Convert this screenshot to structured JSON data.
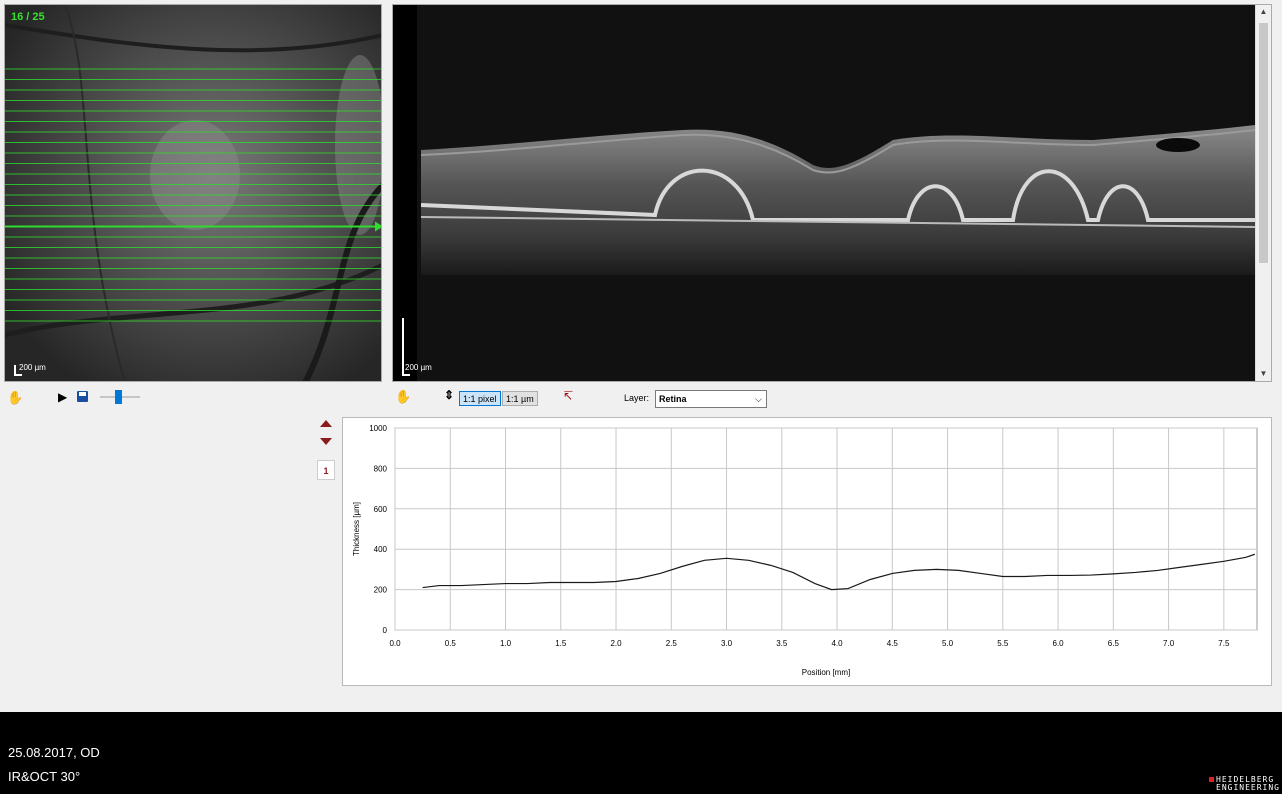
{
  "fundus": {
    "scan_counter": "16 / 25",
    "scale_label": "200 µm",
    "scan_count": 25,
    "selected_scan": 16,
    "scan_color": "#2fdb2f"
  },
  "oct": {
    "scale_label": "200 µm"
  },
  "toolbar": {
    "pan_icon": "hand-icon",
    "play_icon": "play-icon",
    "save_icon": "save-icon",
    "brightness_level": 0.45,
    "pixel_label": "1:1 pixel",
    "micron_label": "1:1 µm",
    "layer_label": "Layer:",
    "layer_value": "Retina"
  },
  "side_controls": {
    "up_icon": "arrow-up-icon",
    "down_icon": "arrow-down-icon",
    "badge": "1"
  },
  "chart_data": {
    "type": "line",
    "xlabel": "Position [mm]",
    "ylabel": "Thickness [µm]",
    "xlim": [
      0.0,
      7.8
    ],
    "ylim": [
      0,
      1000
    ],
    "xticks": [
      "0.0",
      "0.5",
      "1.0",
      "1.5",
      "2.0",
      "2.5",
      "3.0",
      "3.5",
      "4.0",
      "4.5",
      "5.0",
      "5.5",
      "6.0",
      "6.5",
      "7.0",
      "7.5"
    ],
    "yticks": [
      "0",
      "200",
      "400",
      "600",
      "800",
      "1000"
    ],
    "grid": true,
    "x": [
      0.25,
      0.4,
      0.6,
      0.8,
      1.0,
      1.2,
      1.4,
      1.6,
      1.8,
      2.0,
      2.2,
      2.4,
      2.6,
      2.8,
      3.0,
      3.2,
      3.4,
      3.6,
      3.8,
      3.95,
      4.1,
      4.3,
      4.5,
      4.7,
      4.9,
      5.1,
      5.3,
      5.5,
      5.7,
      5.9,
      6.1,
      6.3,
      6.5,
      6.7,
      6.9,
      7.1,
      7.3,
      7.5,
      7.7,
      7.78
    ],
    "y": [
      210,
      220,
      220,
      225,
      230,
      230,
      235,
      235,
      235,
      240,
      255,
      280,
      315,
      345,
      355,
      345,
      320,
      285,
      230,
      200,
      205,
      250,
      280,
      295,
      300,
      295,
      280,
      265,
      265,
      270,
      270,
      272,
      278,
      285,
      295,
      310,
      325,
      340,
      360,
      375
    ],
    "line_color": "#1a1a1a"
  },
  "footer": {
    "date_eye": "25.08.2017, OD",
    "modality": "IR&OCT 30°",
    "logo_line1": "HEIDELBERG",
    "logo_line2": "ENGINEERING"
  }
}
